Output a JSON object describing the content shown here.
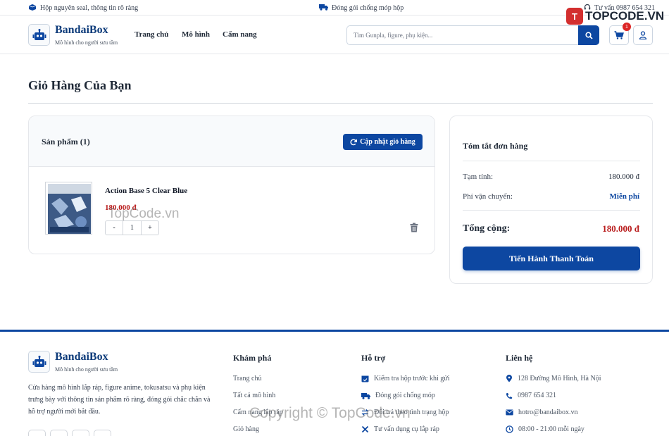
{
  "topbar": {
    "left_text": "Hộp nguyên seal, thông tin rõ ràng",
    "center_text": "Đóng gói chống móp hộp",
    "right_text": "Tư vấn 0987 654 321"
  },
  "header": {
    "brand": "BandaiBox",
    "tagline": "Mô hình cho người sưu tầm",
    "nav": [
      "Trang chủ",
      "Mô hình",
      "Cẩm nang"
    ],
    "search_placeholder": "Tìm Gunpla, figure, phụ kiện...",
    "cart_count": "1"
  },
  "page": {
    "title": "Giỏ Hàng Của Bạn"
  },
  "cart": {
    "heading": "Sản phẩm (1)",
    "update_label": "Cập nhật giỏ hàng",
    "items": [
      {
        "name": "Action Base 5 Clear Blue",
        "price": "180.000 đ",
        "qty": "1",
        "minus": "-",
        "plus": "+"
      }
    ]
  },
  "summary": {
    "title": "Tóm tắt đơn hàng",
    "subtotal_label": "Tạm tính:",
    "subtotal_value": "180.000 đ",
    "shipping_label": "Phí vận chuyển:",
    "shipping_value": "Miễn phí",
    "total_label": "Tổng cộng:",
    "total_value": "180.000 đ",
    "checkout_label": "Tiến Hành Thanh Toán"
  },
  "footer": {
    "brand": "BandaiBox",
    "tagline": "Mô hình cho người sưu tầm",
    "description": "Cửa hàng mô hình lắp ráp, figure anime, tokusatsu và phụ kiện trưng bày với thông tin sản phẩm rõ ràng, đóng gói chắc chắn và hỗ trợ người mới bắt đầu.",
    "explore": {
      "title": "Khám phá",
      "links": [
        "Trang chủ",
        "Tất cả mô hình",
        "Cẩm nang lắp ráp",
        "Giỏ hàng"
      ]
    },
    "support": {
      "title": "Hỗ trợ",
      "links": [
        "Kiểm tra hộp trước khi gửi",
        "Đóng gói chống móp",
        "Đổi trả theo tình trạng hộp",
        "Tư vấn dụng cụ lắp ráp"
      ]
    },
    "contact": {
      "title": "Liên hệ",
      "address": "128 Đường Mô Hình, Hà Nội",
      "phone": "0987 654 321",
      "email": "hotro@bandaibox.vn",
      "hours": "08:00 - 21:00 mỗi ngày"
    }
  },
  "watermarks": {
    "logo_text": "TOPCODE.VN",
    "logo_mark": "T",
    "mid": "TopCode.vn",
    "bottom": "Copyright © TopCode.vn"
  },
  "colors": {
    "primary": "#0d47a1",
    "price": "#b91c1c",
    "badge": "#dc2626"
  }
}
